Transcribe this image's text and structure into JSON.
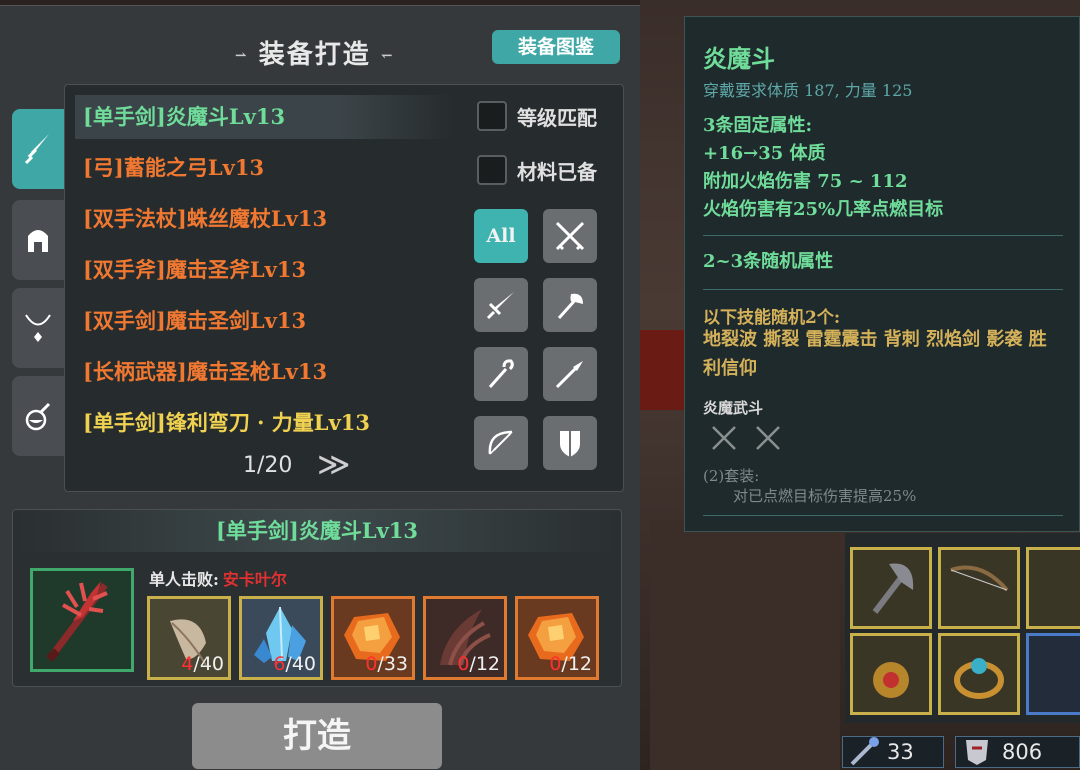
{
  "header": {
    "title": "装备打造",
    "arrow_left": "⇀",
    "arrow_right": "↽",
    "codex_label": "装备图鉴"
  },
  "tabs": [
    {
      "icon": "sword-icon",
      "glyph": "🗡",
      "active": true
    },
    {
      "icon": "helmet-icon",
      "glyph": "⛑",
      "active": false
    },
    {
      "icon": "necklace-icon",
      "glyph": "ᘎ",
      "active": false
    },
    {
      "icon": "potion-icon",
      "glyph": "⚗",
      "active": false
    }
  ],
  "recipes": [
    {
      "label": "[单手剑]炎魔斗Lv13",
      "color": "green"
    },
    {
      "label": "[弓]蓄能之弓Lv13",
      "color": "orange"
    },
    {
      "label": "[双手法杖]蛛丝魔杖Lv13",
      "color": "orange"
    },
    {
      "label": "[双手斧]魔击圣斧Lv13",
      "color": "orange"
    },
    {
      "label": "[双手剑]魔击圣剑Lv13",
      "color": "orange"
    },
    {
      "label": "[长柄武器]魔击圣枪Lv13",
      "color": "orange"
    },
    {
      "label": "[单手剑]锋利弯刀 · 力量Lv13",
      "color": "yellow"
    }
  ],
  "pager": {
    "text": "1/20",
    "next": "≫"
  },
  "filters": {
    "level_match": "等级匹配",
    "materials_ready": "材料已备",
    "all_label": "All",
    "buttons": [
      {
        "icon": "crossed-swords-icon",
        "glyph": "⚔"
      },
      {
        "icon": "sword-icon",
        "glyph": "🗡"
      },
      {
        "icon": "axe-icon",
        "glyph": "🪓"
      },
      {
        "icon": "staff-icon",
        "glyph": "⚚"
      },
      {
        "icon": "spear-icon",
        "glyph": "➚"
      },
      {
        "icon": "bow-icon",
        "glyph": "🏹"
      },
      {
        "icon": "shield-icon",
        "glyph": "⛨"
      }
    ]
  },
  "materials": {
    "title": "[单手剑]炎魔斗Lv13",
    "kill_label": "单人击败:",
    "boss_name": "安卡叶尔",
    "items": [
      {
        "icon": "feather-icon",
        "have": "4",
        "need": "/40",
        "border": "#c8b04a",
        "bg": "#4a4634"
      },
      {
        "icon": "crystal-icon",
        "have": "6",
        "need": "/40",
        "border": "#c8b04a",
        "bg": "#3a4a5a"
      },
      {
        "icon": "fire-gem-icon",
        "have": "0",
        "need": "/33",
        "border": "#e07a30",
        "bg": "#6a3a20"
      },
      {
        "icon": "claw-icon",
        "have": "0",
        "need": "/12",
        "border": "#e07a30",
        "bg": "#3e2a26"
      },
      {
        "icon": "fire-gem-icon",
        "have": "0",
        "need": "/12",
        "border": "#e07a30",
        "bg": "#6a3a20"
      }
    ]
  },
  "forge_label": "打造",
  "tooltip": {
    "name": "炎魔斗",
    "requirement": "穿戴要求体质 187, 力量 125",
    "fixed_header": "3条固定属性:",
    "fixed_attrs": [
      "+16→35 体质",
      "附加火焰伤害 75 ~ 112",
      "火焰伤害有25%几率点燃目标"
    ],
    "random_attrs": "2~3条随机属性",
    "skills_header": "以下技能随机2个:",
    "skills": "地裂波 撕裂 雷霆震击 背刺 烈焰剑 影袭 胜利信仰",
    "set_name": "炎魔武斗",
    "set_count": "(2)套装:",
    "set_bonus": "对已点燃目标伤害提高25%"
  },
  "stats": {
    "attack": "33",
    "defense": "806"
  }
}
